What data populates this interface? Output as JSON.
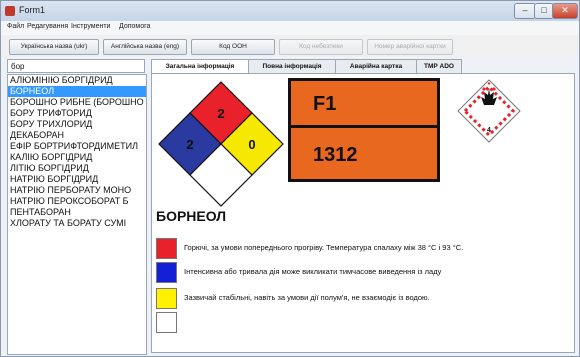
{
  "window": {
    "title": "Form1",
    "controls": {
      "minimize": "–",
      "maximize": "□",
      "close": "✕"
    }
  },
  "menu": [
    "Файл",
    "Редагування",
    "Інструменти",
    "Допомога"
  ],
  "toolbar": {
    "buttons": [
      {
        "label": "Українська назва (ukr)",
        "enabled": true
      },
      {
        "label": "Англійська назва (eng)",
        "enabled": true
      },
      {
        "label": "Код ООН",
        "enabled": true
      },
      {
        "label": "Код небезпеки",
        "enabled": false
      },
      {
        "label": "Номер аварійної картки",
        "enabled": false
      }
    ]
  },
  "search": {
    "value": "бор"
  },
  "substances": [
    "АЛЮМІНІЮ БОРГІДРИД",
    "БОРНЕОЛ",
    "БОРОШНО РИБНЕ (БОРОШНО",
    "БОРУ ТРИФТОРИД",
    "БОРУ ТРИХЛОРИД",
    "ДЕКАБОРАН",
    "ЕФІР БОРТРИФТОРДИМЕТИЛ",
    "КАЛІЮ БОРГІДРИД",
    "ЛІТІЮ БОРГІДРИД",
    "НАТРІЮ БОРГІДРИД",
    "НАТРІЮ ПЕРБОРАТУ МОНО",
    "НАТРІЮ ПЕРОКСОБОРАТ Б",
    "ПЕНТАБОРАН",
    "ХЛОРАТУ ТА БОРАТУ СУМІ"
  ],
  "selected_index": 1,
  "tabs": [
    {
      "label": "Загальна інформація",
      "active": true
    },
    {
      "label": "Повна інформація",
      "active": false
    },
    {
      "label": "Аварійна картка",
      "active": false
    },
    {
      "label": "ТМР АDО",
      "active": false
    }
  ],
  "nfpa": {
    "health": "2",
    "flammability": "2",
    "reactivity": "0",
    "special": ""
  },
  "placard": {
    "hazard_code": "F1",
    "un_number": "1312"
  },
  "hazard_symbol": {
    "icon": "flammable-solid-diamond-icon",
    "label": "4"
  },
  "substance_name": "БОРНЕОЛ",
  "legend": [
    {
      "color": "#e8212a",
      "text": "Горючі, за умови попереднього прогріву. Температура спалаху між 38 °C і 93 °C."
    },
    {
      "color": "#1220d6",
      "text": "Інтенсивна або тривала дія може викликати тимчасове виведення із ладу"
    },
    {
      "color": "#fff200",
      "text": "Зазвичай стабільні, навіть за умови дії полум'я, не взаємодіє із водою."
    },
    {
      "color": "#ffffff",
      "text": ""
    }
  ],
  "colors": {
    "nfpa_red": "#e8212a",
    "nfpa_blue": "#2a3aa0",
    "nfpa_yellow": "#f7e800",
    "placard_orange": "#e8681f",
    "selection": "#3399ff"
  }
}
